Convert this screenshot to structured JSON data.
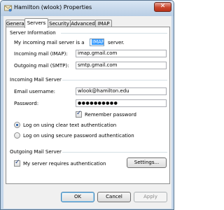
{
  "window": {
    "title": "Hamilton (wlook) Properties",
    "close_label": "✕"
  },
  "tabs": [
    {
      "label": "General"
    },
    {
      "label": "Servers"
    },
    {
      "label": "Security"
    },
    {
      "label": "Advanced"
    },
    {
      "label": "IMAP"
    }
  ],
  "server_information": {
    "heading": "Server Information",
    "type_prefix": "My incoming mail server is a",
    "type_value": "IMAP",
    "type_suffix": "server.",
    "incoming_label": "Incoming mail (IMAP):",
    "incoming_value": "imap.gmail.com",
    "outgoing_label": "Outgoing mail (SMTP):",
    "outgoing_value": "smtp.gmail.com"
  },
  "incoming_server": {
    "heading": "Incoming Mail Server",
    "username_label": "Email username:",
    "username_value": "wlook@hamilton.edu",
    "password_label": "Password:",
    "password_value": "●●●●●●●●●●",
    "remember_label": "Remember password",
    "clear_text_label": "Log on using clear text authentication",
    "secure_label": "Log on using secure password authentication"
  },
  "outgoing_server": {
    "heading": "Outgoing Mail Server",
    "requires_auth_label": "My server requires authentication",
    "settings_label": "Settings..."
  },
  "buttons": {
    "ok": "OK",
    "cancel": "Cancel",
    "apply": "Apply"
  }
}
